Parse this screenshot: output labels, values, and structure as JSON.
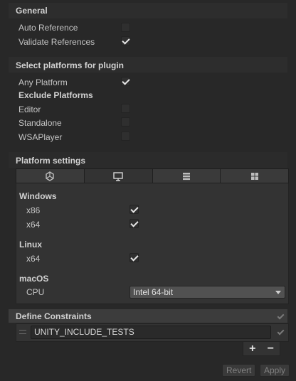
{
  "general": {
    "title": "General",
    "auto_reference": {
      "label": "Auto Reference",
      "checked": false
    },
    "validate_references": {
      "label": "Validate References",
      "checked": true
    }
  },
  "platforms": {
    "title": "Select platforms for plugin",
    "any_platform": {
      "label": "Any Platform",
      "checked": true
    },
    "exclude_title": "Exclude Platforms",
    "exclude": [
      {
        "label": "Editor",
        "checked": false
      },
      {
        "label": "Standalone",
        "checked": false
      },
      {
        "label": "WSAPlayer",
        "checked": false
      }
    ]
  },
  "platform_settings": {
    "title": "Platform settings",
    "tabs": [
      {
        "icon": "unity-logo-icon",
        "active": false
      },
      {
        "icon": "monitor-icon",
        "active": true
      },
      {
        "icon": "server-icon",
        "active": false
      },
      {
        "icon": "windows-logo-icon",
        "active": false
      }
    ],
    "windows": {
      "title": "Windows",
      "x86": {
        "label": "x86",
        "checked": true
      },
      "x64": {
        "label": "x64",
        "checked": true
      }
    },
    "linux": {
      "title": "Linux",
      "x64": {
        "label": "x64",
        "checked": true
      }
    },
    "macos": {
      "title": "macOS",
      "cpu_label": "CPU",
      "cpu_value": "Intel 64-bit"
    }
  },
  "define_constraints": {
    "title": "Define Constraints",
    "items": [
      "UNITY_INCLUDE_TESTS"
    ],
    "add_label": "+",
    "remove_label": "−"
  },
  "footer": {
    "revert_label": "Revert",
    "apply_label": "Apply"
  },
  "colors": {
    "background": "#282828",
    "panel": "#333333",
    "text": "#c4c4c4"
  }
}
